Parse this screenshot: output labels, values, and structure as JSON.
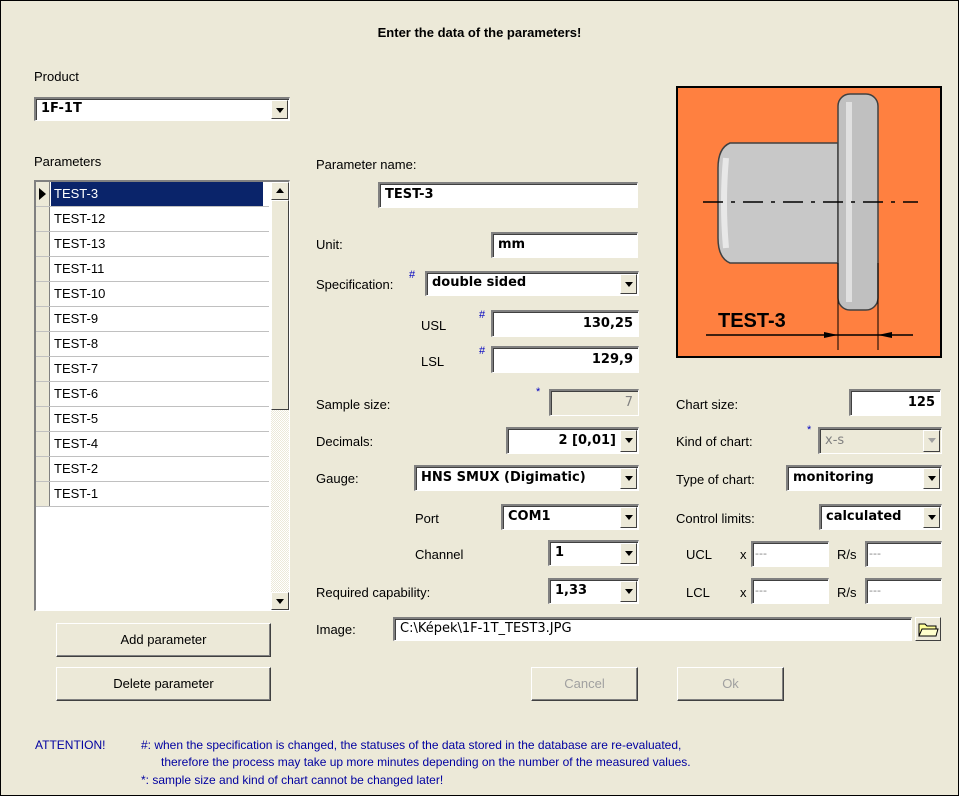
{
  "title": "Enter the data of the parameters!",
  "product": {
    "label": "Product",
    "value": "1F-1T"
  },
  "parameters": {
    "label": "Parameters",
    "items": [
      "TEST-3",
      "TEST-12",
      "TEST-13",
      "TEST-11",
      "TEST-10",
      "TEST-9",
      "TEST-8",
      "TEST-7",
      "TEST-6",
      "TEST-5",
      "TEST-4",
      "TEST-2",
      "TEST-1"
    ],
    "selected": "TEST-3"
  },
  "form": {
    "param_name_label": "Parameter name:",
    "param_name": "TEST-3",
    "unit_label": "Unit:",
    "unit": "mm",
    "spec_label": "Specification:",
    "spec": "double sided",
    "usl_label": "USL",
    "usl": "130,25",
    "lsl_label": "LSL",
    "lsl": "129,9",
    "sample_size_label": "Sample size:",
    "sample_size": "7",
    "decimals_label": "Decimals:",
    "decimals": "2 [0,01]",
    "gauge_label": "Gauge:",
    "gauge": "HNS SMUX (Digimatic)",
    "port_label": "Port",
    "port": "COM1",
    "channel_label": "Channel",
    "channel": "1",
    "req_cap_label": "Required capability:",
    "req_cap": "1,33",
    "image_label": "Image:",
    "image_path": "C:\\Képek\\1F-1T_TEST3.JPG",
    "chart_size_label": "Chart size:",
    "chart_size": "125",
    "kind_label": "Kind of chart:",
    "kind": "x-s",
    "type_label": "Type of chart:",
    "type": "monitoring",
    "control_limits_label": "Control limits:",
    "control_limits": "calculated",
    "ucl_label": "UCL",
    "lcl_label": "LCL",
    "x_label": "x",
    "rs_label": "R/s",
    "ucl_x": "---",
    "ucl_rs": "---",
    "lcl_x": "---",
    "lcl_rs": "---",
    "hash": "#",
    "star": "*"
  },
  "image_caption": "TEST-3",
  "buttons": {
    "add": "Add parameter",
    "delete": "Delete parameter",
    "cancel": "Cancel",
    "ok": "Ok"
  },
  "notes": {
    "attention": "ATTENTION!",
    "hash_line1": "#: when the specification is changed, the statuses of the data stored in the database are re-evaluated,",
    "hash_line2": "therefore the process may take up more minutes depending on the number of the measured values.",
    "star_line": "*: sample size and kind of chart cannot be changed later!"
  },
  "colors": {
    "image_bg": "#ff8040",
    "selection": "#0a246a",
    "note_text": "#0000a0"
  }
}
